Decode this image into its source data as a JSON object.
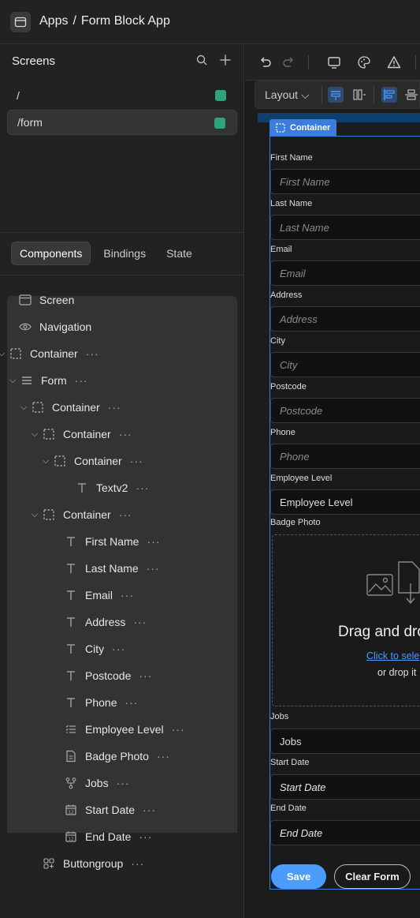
{
  "header": {
    "apps_label": "Apps",
    "separator": "/",
    "app_name": "Form Block App"
  },
  "screens": {
    "title": "Screens",
    "items": [
      {
        "label": "/"
      },
      {
        "label": "/form"
      }
    ]
  },
  "tabs": [
    "Components",
    "Bindings",
    "State"
  ],
  "tree": {
    "screen": "Screen",
    "navigation": "Navigation",
    "nodes": [
      {
        "label": "Container",
        "icon": "container-icon"
      },
      {
        "label": "Form",
        "icon": "form-icon"
      },
      {
        "label": "Container",
        "icon": "container-icon"
      },
      {
        "label": "Container",
        "icon": "container-icon"
      },
      {
        "label": "Container",
        "icon": "container-icon"
      },
      {
        "label": "Textv2",
        "icon": "text-icon"
      },
      {
        "label": "Container",
        "icon": "container-icon"
      },
      {
        "label": "First Name",
        "icon": "text-icon"
      },
      {
        "label": "Last Name",
        "icon": "text-icon"
      },
      {
        "label": "Email",
        "icon": "text-icon"
      },
      {
        "label": "Address",
        "icon": "text-icon"
      },
      {
        "label": "City",
        "icon": "text-icon"
      },
      {
        "label": "Postcode",
        "icon": "text-icon"
      },
      {
        "label": "Phone",
        "icon": "text-icon"
      },
      {
        "label": "Employee Level",
        "icon": "list-icon"
      },
      {
        "label": "Badge Photo",
        "icon": "file-icon"
      },
      {
        "label": "Jobs",
        "icon": "relationship-icon"
      },
      {
        "label": "Start Date",
        "icon": "calendar-icon"
      },
      {
        "label": "End Date",
        "icon": "calendar-icon"
      },
      {
        "label": "Buttongroup",
        "icon": "buttongroup-icon"
      }
    ]
  },
  "toolbar": {
    "layout_label": "Layout"
  },
  "preview": {
    "container_badge": "Container",
    "fields": [
      {
        "label": "First Name",
        "placeholder": "First Name"
      },
      {
        "label": "Last Name",
        "placeholder": "Last Name"
      },
      {
        "label": "Email",
        "placeholder": "Email"
      },
      {
        "label": "Address",
        "placeholder": "Address"
      },
      {
        "label": "City",
        "placeholder": "City"
      },
      {
        "label": "Postcode",
        "placeholder": "Postcode"
      },
      {
        "label": "Phone",
        "placeholder": "Phone"
      },
      {
        "label": "Employee Level",
        "placeholder": "Employee Level"
      }
    ],
    "badge_photo_label": "Badge Photo",
    "dropzone": {
      "title": "Drag and dro",
      "link": "Click to sele",
      "sub": "or drop it"
    },
    "jobs": {
      "label": "Jobs",
      "placeholder": "Jobs"
    },
    "start_date": {
      "label": "Start Date",
      "placeholder": "Start Date"
    },
    "end_date": {
      "label": "End Date",
      "placeholder": "End Date"
    },
    "save_label": "Save",
    "clear_label": "Clear Form"
  },
  "colors": {
    "accent": "#4a9dff",
    "selection": "#3b7ddd",
    "screen_dot": "#2fa37a"
  }
}
